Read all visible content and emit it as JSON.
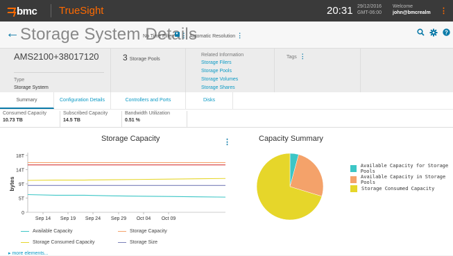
{
  "topbar": {
    "brand": "bmc",
    "product": "TrueSight",
    "time": "20:31",
    "date_line1": "29/12/2016",
    "date_line2": "GMT-06:00",
    "welcome_label": "Welcome",
    "user": "john@bmcrealm"
  },
  "header": {
    "title": "Storage System Details",
    "time_filter": "No Time Filter",
    "resolution": "Automatic Resolution"
  },
  "info": {
    "system_name": "AMS2100+38017120",
    "type_label": "Type",
    "type_value": "Storage System",
    "pool_count": "3",
    "pool_label": "Storage Pools",
    "related_label": "Related Information",
    "related_links": [
      "Storage Filers",
      "Storage Pools",
      "Storage Volumes",
      "Storage Shares"
    ],
    "tags_label": "Tags"
  },
  "tabs": [
    "Summary",
    "Configuration Details",
    "Controllers and Ports",
    "Disks"
  ],
  "metrics": [
    {
      "label": "Consumed Capacity",
      "value": "10.73 TB"
    },
    {
      "label": "Subscribed Capacity",
      "value": "14.5 TB"
    },
    {
      "label": "Bandwidth Utilization",
      "value": "0.51 %"
    }
  ],
  "more_link": "more elements...",
  "colors": {
    "accent": "#0b7aa8",
    "brand_orange": "#ff6a00",
    "available": "#3cc6c6",
    "storage_capacity": "#f4a26a",
    "consumed": "#e6d62a",
    "storage_size": "#7a7fb8",
    "red_line": "#d73838"
  },
  "chart_data": [
    {
      "type": "line",
      "title": "Storage Capacity",
      "ylabel": "bytes",
      "yticks": [
        "0",
        "5T",
        "9T",
        "14T",
        "18T"
      ],
      "ylim": [
        0,
        18
      ],
      "xticks": [
        "Sep 14",
        "Sep 19",
        "Sep 24",
        "Sep 29",
        "Oct 04",
        "Oct 09"
      ],
      "x": [
        "Sep 12",
        "Sep 14",
        "Sep 19",
        "Sep 24",
        "Sep 29",
        "Oct 04",
        "Oct 09",
        "Oct 13"
      ],
      "series": [
        {
          "name": "Available Capacity",
          "values": [
            5.6,
            5.4,
            5.4,
            5.2,
            5.1,
            5.0,
            4.9,
            4.8
          ]
        },
        {
          "name": "Storage Capacity",
          "values": [
            15.7,
            15.7,
            15.7,
            15.7,
            15.7,
            15.7,
            15.7,
            15.7
          ]
        },
        {
          "name": "Storage Consumed Capacity",
          "values": [
            10.1,
            10.2,
            10.2,
            10.3,
            10.4,
            10.5,
            10.6,
            10.7
          ]
        },
        {
          "name": "Storage Size",
          "values": [
            8.5,
            8.5,
            8.5,
            8.5,
            8.5,
            8.5,
            8.5,
            8.5
          ]
        },
        {
          "name": "",
          "values": [
            15.0,
            15.0,
            15.0,
            15.0,
            15.0,
            15.0,
            15.0,
            15.0
          ]
        }
      ]
    },
    {
      "type": "pie",
      "title": "Capacity Summary",
      "categories": [
        "Available Capacity for Storage Pools",
        "Available Capacity in Storage Pools",
        "Storage Consumed Capacity"
      ],
      "values": [
        4.2,
        25.5,
        70.3
      ]
    }
  ]
}
